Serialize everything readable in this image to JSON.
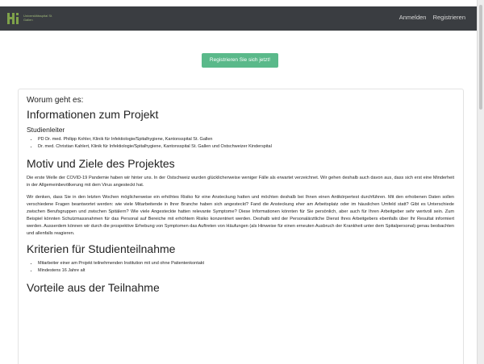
{
  "navbar": {
    "logo_text": "Universitätsspital St. Gallen",
    "links": [
      "Anmelden",
      "Registrieren"
    ]
  },
  "cta_label": "Registrieren Sie sich jetzt!",
  "content": {
    "worum": "Worum geht es:",
    "info_heading": "Informationen zum Projekt",
    "studienleiter_label": "Studienleiter",
    "studienleiter": [
      "PD Dr. med. Philipp Kohler, Klinik für Infektiologie/Spitalhygiene, Kantonsspital St. Gallen",
      "Dr. med. Christian Kahlert, Klinik für Infektiologie/Spitalhygiene, Kantonsspital St. Gallen und Ostschweizer Kinderspital"
    ],
    "motiv_heading": "Motiv und Ziele des Projektes",
    "paragraphs": [
      "Die erste Welle der COVID-19 Pandemie haben wir hinter uns. In der Ostschweiz wurden glücklicherweise weniger Fälle als erwartet verzeichnet. Wir gehen deshalb auch davon aus, dass sich erst eine Minderheit in der Allgemeinbevölkerung mit dem Virus angesteckt hat.",
      "Wir denken, dass Sie in den letzten Wochen möglicherweise ein erhöhtes Risiko für eine Ansteckung hatten und möchten deshalb bei Ihnen einen Antikörpertest durchführen. Mit den erhobenen Daten sollen verschiedene Fragen beantwortet werden: wie viele Mitarbeitende in Ihrer Branche haben sich angesteckt? Fand die Ansteckung eher am Arbeitsplatz oder im häuslichen Umfeld statt? Gibt es Unterschiede zwischen Berufsgruppen und zwischen Spitälern? Wie viele Angesteckte hatten relevante Symptome? Diese Informationen könnten für Sie persönlich, aber auch für Ihren Arbeitgeber sehr wertvoll sein. Zum Beispiel könnten Schutzmassnahmen für das Personal auf Bereiche mit erhöhtem Risiko konzentriert werden. Deshalb wird der Personalärztliche Dienst Ihres Arbeitgebers ebenfalls über Ihr Resultat informiert werden. Ausserdem können wir durch die prospektive Erhebung von Symptomen das Auftreten von Häufungen (als Hinweise für einen erneuten Ausbruch der Krankheit unter dem Spitalpersonal) genau beobachten und allenfalls reagieren."
    ],
    "kriterien_heading": "Kriterien für Studienteilnahme",
    "kriterien": [
      "Mitarbeiter einer am Projekt teilnehmenden Institution mit und ohne Patientenkontakt",
      "Mindestens 16 Jahre alt"
    ],
    "vorteile_heading": "Vorteile aus der Teilnahme"
  },
  "colors": {
    "navbar": "#3a3d41",
    "accent": "#5ab98a",
    "logo": "#7fa24a"
  }
}
